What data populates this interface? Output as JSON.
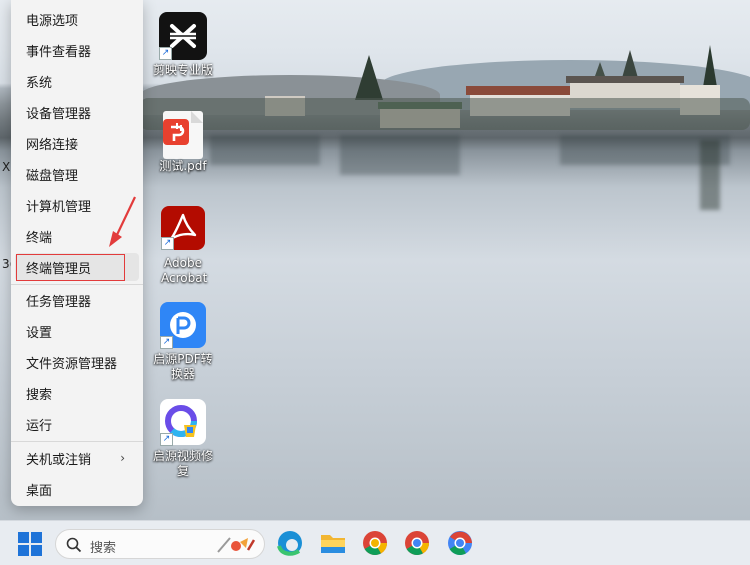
{
  "context_menu": {
    "items": [
      {
        "label": "电源选项"
      },
      {
        "label": "事件查看器"
      },
      {
        "label": "系统"
      },
      {
        "label": "设备管理器"
      },
      {
        "label": "网络连接"
      },
      {
        "label": "磁盘管理"
      },
      {
        "label": "计算机管理"
      },
      {
        "label": "终端"
      },
      {
        "label": "终端管理员"
      },
      {
        "label": "任务管理器"
      },
      {
        "label": "设置"
      },
      {
        "label": "文件资源管理器"
      },
      {
        "label": "搜索"
      },
      {
        "label": "运行"
      },
      {
        "label": "关机或注销"
      },
      {
        "label": "桌面"
      }
    ],
    "highlighted_item": "终端管理员",
    "submenu_chevron": "›"
  },
  "edge_fragments": [
    "X",
    "3("
  ],
  "desktop_icons": [
    {
      "label": "剪映专业版",
      "icon": "capcut-icon",
      "color": "#111111"
    },
    {
      "label": "测试.pdf",
      "icon": "pdf-file-icon",
      "color": "#e8412f"
    },
    {
      "label": "Adobe Acrobat",
      "icon": "adobe-acrobat-icon",
      "color": "#b30b00"
    },
    {
      "label": "启源PDF转换器",
      "icon": "pdf-converter-icon",
      "color": "#2f86f6"
    },
    {
      "label": "启源视频修复",
      "icon": "video-repair-icon",
      "color": "#6a4de8"
    }
  ],
  "taskbar": {
    "search_placeholder": "搜索",
    "icons": [
      "windows-start-icon",
      "search-icon",
      "edge-icon",
      "file-explorer-icon",
      "chrome-variant-icon",
      "chrome-icon",
      "google-chrome-icon"
    ]
  },
  "colors": {
    "annotation_red": "#e23b3b",
    "windows_blue": "#1e73d8"
  }
}
